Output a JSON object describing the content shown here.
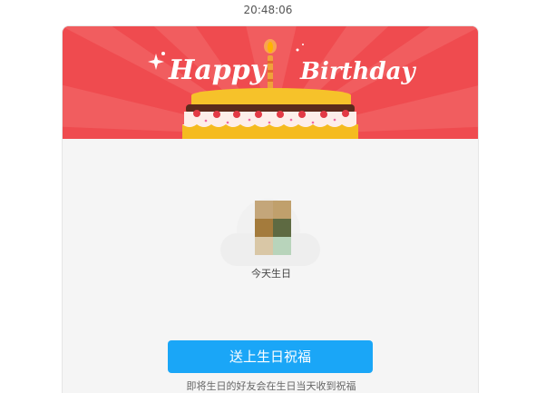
{
  "header": {
    "time": "20:48:06"
  },
  "banner": {
    "word_left": "Happy",
    "word_right": "Birthday",
    "background_color": "#ef4b4f"
  },
  "friend": {
    "avatar_icon": "blurred-avatar",
    "label": "今天生日"
  },
  "actions": {
    "send_label": "送上生日祝福",
    "hint": "即将生日的好友会在生日当天收到祝福",
    "accent_color": "#1aa6f7"
  }
}
